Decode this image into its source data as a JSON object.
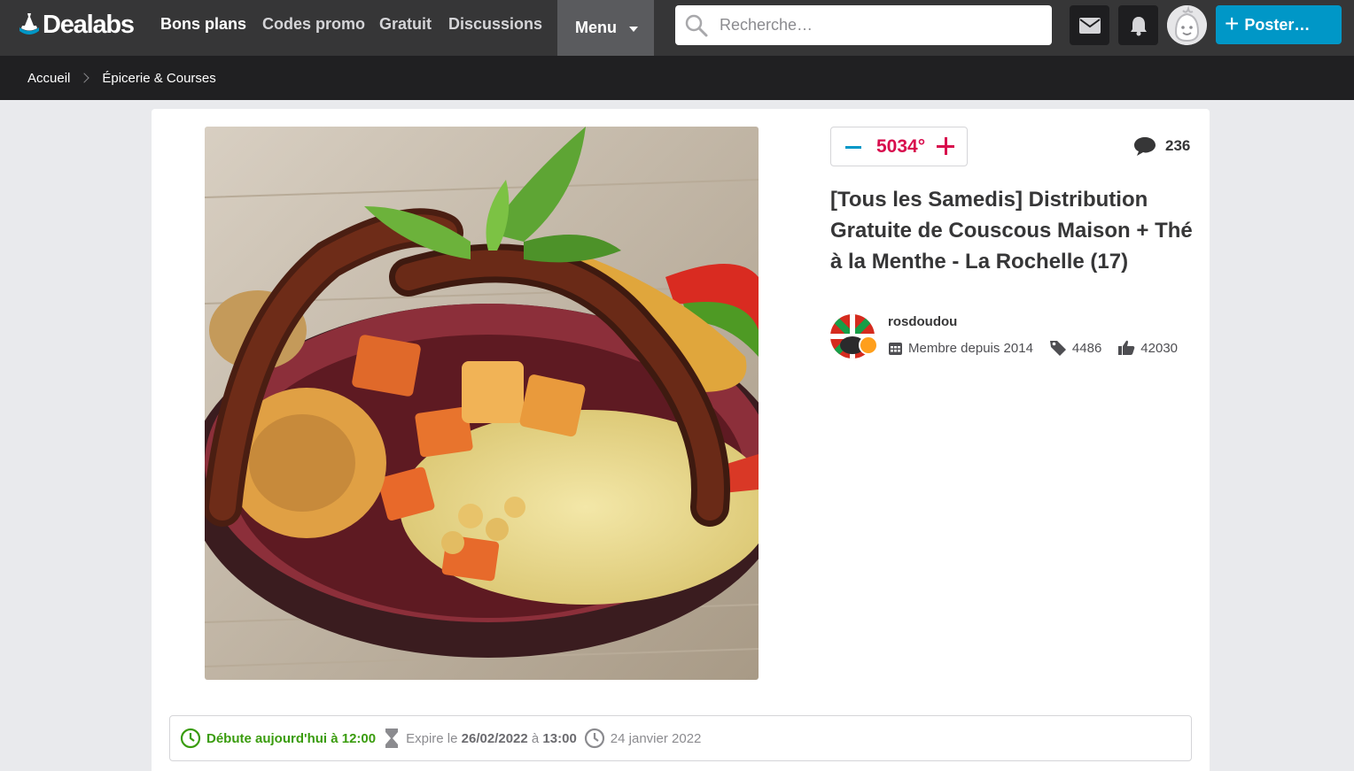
{
  "header": {
    "logo_text": "Dealabs",
    "nav": [
      "Bons plans",
      "Codes promo",
      "Gratuit",
      "Discussions"
    ],
    "menu_label": "Menu",
    "search_placeholder": "Recherche…",
    "post_label": "Poster…",
    "icons": [
      "mail-icon",
      "bell-icon",
      "user-avatar-icon",
      "plus-icon"
    ]
  },
  "breadcrumb": {
    "items": [
      "Accueil",
      "Épicerie & Courses"
    ]
  },
  "deal": {
    "temperature": "5034°",
    "comments_count": "236",
    "title": "[Tous les Samedis] Distribution Gratuite de Couscous Maison + Thé à la Menthe - La Rochelle (17)",
    "image_alt": "Couscous avec merguez, légumes et menthe"
  },
  "user": {
    "name": "rosdoudou",
    "member_since": "Membre depuis 2014",
    "deals_count": "4486",
    "likes_count": "42030"
  },
  "dates": {
    "start_prefix": "Débute aujourd'hui à",
    "start_time": "12:00",
    "expire_prefix": "Expire le",
    "expire_date": "26/02/2022",
    "expire_sep": "à",
    "expire_time": "13:00",
    "posted": "24 janvier 2022"
  },
  "colors": {
    "header_bg": "#363637",
    "crumb_bg": "#202022",
    "accent": "#0097c7",
    "hot": "#d80d4d",
    "start_green": "#3a9c0e"
  }
}
